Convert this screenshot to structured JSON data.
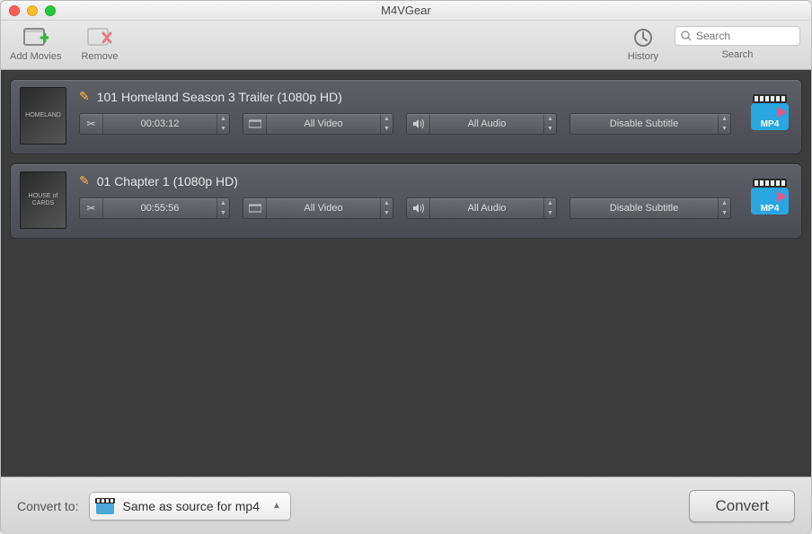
{
  "window": {
    "title": "M4VGear"
  },
  "toolbar": {
    "add_label": "Add Movies",
    "remove_label": "Remove",
    "history_label": "History",
    "search_placeholder": "Search",
    "search_label": "Search"
  },
  "items": [
    {
      "title": "101 Homeland Season 3 Trailer (1080p HD)",
      "thumb_text": "HOMELAND",
      "duration": "00:03:12",
      "video": "All Video",
      "audio": "All Audio",
      "subtitle": "Disable Subtitle",
      "format_badge": "MP4"
    },
    {
      "title": "01 Chapter 1 (1080p HD)",
      "thumb_text": "HOUSE of CARDS",
      "duration": "00:55:56",
      "video": "All Video",
      "audio": "All Audio",
      "subtitle": "Disable Subtitle",
      "format_badge": "MP4"
    }
  ],
  "footer": {
    "convert_to_label": "Convert to:",
    "format_selected": "Same as source for mp4",
    "convert_button": "Convert"
  }
}
